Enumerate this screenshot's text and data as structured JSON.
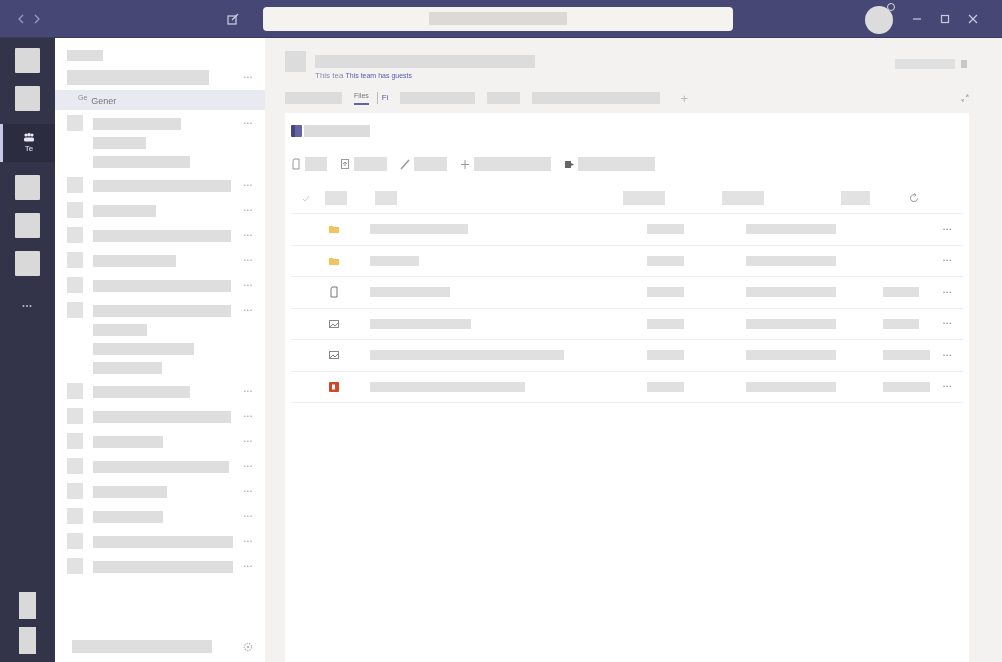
{
  "rail": {
    "items": [
      {
        "kind": "tile",
        "selected": false
      },
      {
        "kind": "tile",
        "selected": false
      },
      {
        "kind": "teams",
        "label": "Te",
        "selected": true
      },
      {
        "kind": "tile",
        "selected": false
      },
      {
        "kind": "tile",
        "selected": false
      },
      {
        "kind": "tile",
        "selected": false
      },
      {
        "kind": "more",
        "label": "•••",
        "selected": false
      }
    ]
  },
  "channels": {
    "team_menu": "•••",
    "channel": {
      "prefix": "Ge",
      "label": "Gener",
      "selected": true
    },
    "teams": [
      {
        "kind": "expanded",
        "menu": "•••"
      },
      {
        "kind": "single",
        "menu": "•••"
      },
      {
        "kind": "single",
        "menu": "•••"
      },
      {
        "kind": "single",
        "menu": "•••"
      },
      {
        "kind": "single",
        "menu": "•••"
      },
      {
        "kind": "single",
        "menu": "•••"
      },
      {
        "kind": "expanded",
        "menu": "•••"
      },
      {
        "kind": "single",
        "menu": "•••"
      },
      {
        "kind": "single",
        "menu": "•••"
      },
      {
        "kind": "single",
        "menu": "•••"
      },
      {
        "kind": "single",
        "menu": "•••"
      },
      {
        "kind": "single",
        "menu": "•••"
      },
      {
        "kind": "single",
        "menu": "•••"
      },
      {
        "kind": "single",
        "menu": "•••"
      },
      {
        "kind": "single",
        "menu": "•••"
      }
    ]
  },
  "header": {
    "subtitle_faint": "This tea",
    "subtitle": "This team has guests"
  },
  "tabs": [
    {
      "kind": "redacted",
      "selected": false
    },
    {
      "kind": "text",
      "label": "Files",
      "selected": true
    },
    {
      "kind": "ghost",
      "label": "Fi",
      "selected": false
    },
    {
      "kind": "redacted",
      "selected": false
    },
    {
      "kind": "redacted",
      "selected": false
    },
    {
      "kind": "redacted",
      "selected": false
    },
    {
      "kind": "add",
      "label": "+",
      "selected": false
    }
  ],
  "table": {
    "rows": [
      {
        "kind": "folder",
        "menu": "•••",
        "size": false
      },
      {
        "kind": "folder",
        "menu": "•••",
        "size": false
      },
      {
        "kind": "file",
        "menu": "•••",
        "size": true
      },
      {
        "kind": "image",
        "menu": "•••",
        "size": true
      },
      {
        "kind": "image",
        "menu": "•••",
        "size": true
      },
      {
        "kind": "powerpoint",
        "menu": "•••",
        "size": true
      }
    ]
  }
}
